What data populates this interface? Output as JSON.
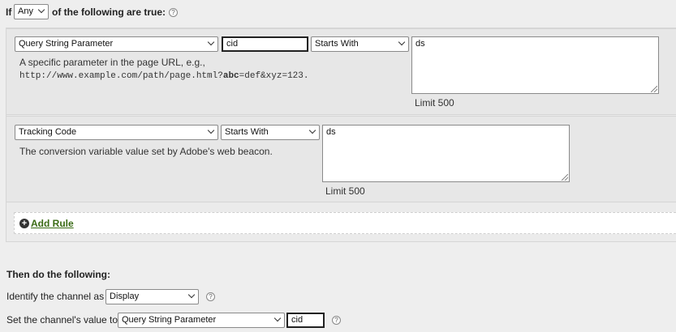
{
  "condition": {
    "prefix": "If",
    "match_select": "Any",
    "suffix": "of the following are true:"
  },
  "rules": [
    {
      "field": "Query String Parameter",
      "param": "cid",
      "operator": "Starts With",
      "value": "ds",
      "description": "A specific parameter in the page URL, e.g.,",
      "example_pre": "http://www.example.com/path/page.html?",
      "example_bold": "abc",
      "example_post": "=def&xyz=123.",
      "limit": "Limit 500"
    },
    {
      "field": "Tracking Code",
      "operator": "Starts With",
      "value": "ds",
      "description": "The conversion variable value set by Adobe's web beacon.",
      "limit": "Limit 500"
    }
  ],
  "add_rule_label": "Add Rule",
  "then": {
    "heading": "Then do the following:",
    "identify_label": "Identify the channel as",
    "channel_select": "Display",
    "value_label": "Set the channel's value to",
    "value_select": "Query String Parameter",
    "value_param": "cid"
  },
  "icons": {
    "help": "help-icon",
    "dropdown": "chevron-down-icon",
    "add": "plus-circle-icon"
  }
}
